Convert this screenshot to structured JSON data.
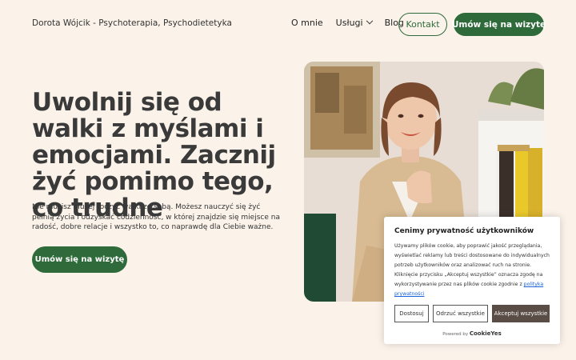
{
  "header": {
    "brand": "Dorota Wójcik - Psychoterapia, Psychodietetyka",
    "nav": [
      {
        "label": "O mnie"
      },
      {
        "label": "Usługi",
        "has_dropdown": true
      },
      {
        "label": "Blog"
      }
    ],
    "contact_label": "Kontakt",
    "cta_label": "Umów się na wizytę"
  },
  "hero": {
    "title": "Uwolnij się od walki z myślami i emocjami. Zacznij żyć pomimo tego, co trudne",
    "text": "Nie musisz dłużej toczyć walki ze sobą. Możesz nauczyć się żyć pełnią życia i odzyskać codzienność, w której znajdzie się miejsce na radość, dobre relacje i wszystko to, co naprawdę dla Ciebie ważne.",
    "cta_label": "Umów się na wizytę"
  },
  "cookie": {
    "title": "Cenimy prywatność użytkowników",
    "body": "Używamy plików cookie, aby poprawić jakość przeglądania, wyświetlać reklamy lub treści dostosowane do indywidualnych potrzeb użytkowników oraz analizować ruch na stronie. Kliknięcie przycisku „Akceptuj wszystkie” oznacza zgodę na wykorzystywanie przez nas plików cookie zgodnie z",
    "link": "polityka prywatności",
    "btn_customize": "Dostosuj",
    "btn_reject": "Odrzuć wszystkie",
    "btn_accept": "Akceptuj wszystkie",
    "powered_by": "Powered by",
    "powered_brand": "CookieYes"
  },
  "colors": {
    "background": "#fbf3ea",
    "accent": "#2f6b3a",
    "accept_button": "#5a4d45",
    "link": "#1863dc"
  }
}
